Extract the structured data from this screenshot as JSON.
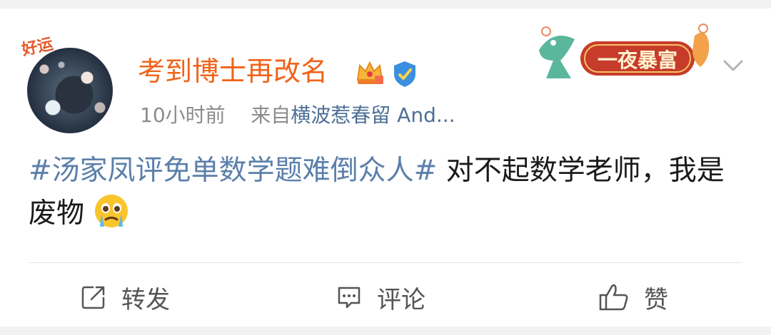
{
  "post": {
    "user": {
      "name": "考到博士再改名",
      "avatar_badge": "好运"
    },
    "meta": {
      "time": "10小时前",
      "from_prefix": "来自",
      "source": "横波惹春留 And..."
    },
    "banner_text": "一夜暴富",
    "content": {
      "hashtag": "#汤家凤评免单数学题难倒众人#",
      "text": " 对不起数学老师，我是废物"
    }
  },
  "actions": {
    "repost": "转发",
    "comment": "评论",
    "like": "赞"
  },
  "icons": [
    "crown-icon",
    "verified-icon",
    "chevron-down-icon",
    "repost-icon",
    "comment-icon",
    "like-icon",
    "crying-emoji-icon"
  ],
  "colors": {
    "username": "#f0631a",
    "hashtag": "#5b7faa",
    "source": "#4d6f96",
    "meta": "#8c8c8c"
  }
}
